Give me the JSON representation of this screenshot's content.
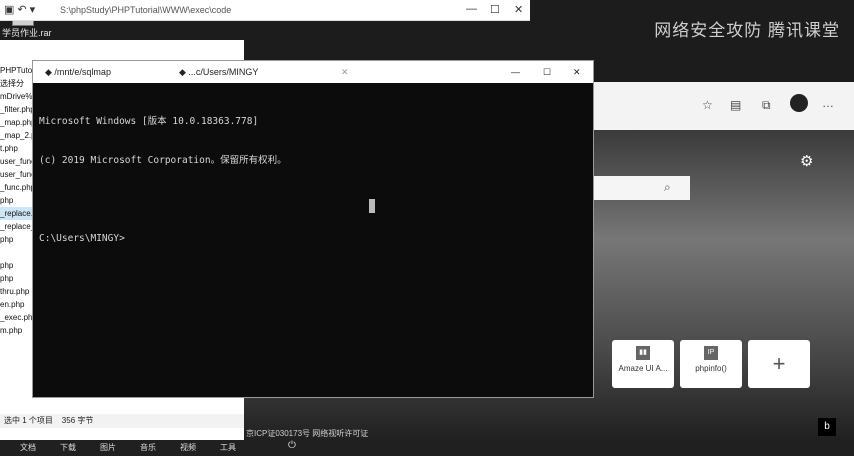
{
  "desktop": {
    "icon_text": "RAR",
    "icon_label": "学员作业.rar",
    "watermark": "网络安全攻防 腾讯课堂"
  },
  "explorer": {
    "path": "S:\\phpStudy\\PHPTutorial\\WWW\\exec\\code",
    "ribbon_labels": [
      "PHPTuto",
      "选择分",
      "mDrive%"
    ],
    "files": [
      "_filter.php",
      "_map.php",
      "_map_2.p",
      "t.php",
      "user_func",
      "user_func_",
      "_func.php",
      "php",
      "_replace.p",
      "_replace_",
      "php",
      "",
      "php",
      "php",
      "thru.php",
      "en.php",
      "_exec.php",
      "m.php"
    ],
    "status_selected": "选中 1 个项目",
    "status_size": "356 字节"
  },
  "terminal": {
    "tab1": "/mnt/e/sqlmap",
    "tab2": "...c/Users/MINGY",
    "lines": [
      "Microsoft Windows [版本 10.0.18363.778]",
      "(c) 2019 Microsoft Corporation。保留所有权利。",
      "",
      "C:\\Users\\MINGY>"
    ]
  },
  "browser": {
    "tiles": [
      {
        "label": "Amaze UI A...",
        "icon": "grid-icon"
      },
      {
        "label": "phpinfo()",
        "icon": "IP"
      },
      {
        "label": "",
        "icon": "+"
      }
    ],
    "footer": "京ICP证030173号  网络视听许可证"
  },
  "taskbar": {
    "items": [
      "文档",
      "下载",
      "图片",
      "音乐",
      "视频",
      "工具"
    ]
  }
}
